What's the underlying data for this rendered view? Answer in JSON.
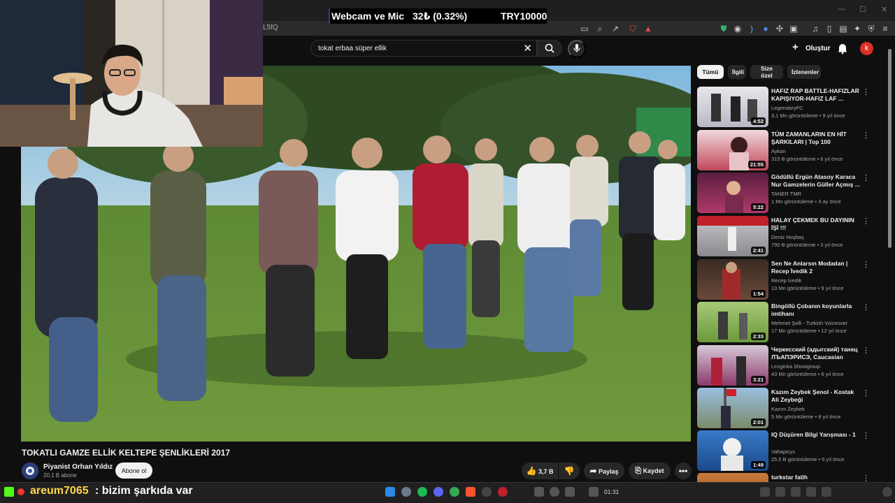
{
  "overlay": {
    "banner_label": "Webcam ve Mic",
    "banner_amount": "32₺ (0.32%)",
    "banner_goal": "TRY10000"
  },
  "browser": {
    "url_fragment": "L5fQ"
  },
  "header": {
    "search_query": "tokat erbaa süper ellik",
    "create_label": "Oluştur",
    "avatar_letter": "k"
  },
  "video": {
    "title": "TOKATLI GAMZE ELLİK KELTEPE ŞENLİKLERİ 2017",
    "channel": "Piyanist Orhan Yıldız",
    "subscribers": "20,1 B abone",
    "subscribe_label": "Abone ol",
    "likes": "3,7 B",
    "share_label": "Paylaş",
    "save_label": "Kaydet"
  },
  "sidebar": {
    "chips": [
      "Tümü",
      "İlgili",
      "Size özel",
      "İzlenenler"
    ],
    "items": [
      {
        "title": "HAFIZ RAP BATTLE-HAFIZLAR KAPIŞIYOR-HAFIZ LAF ...",
        "channel": "LegendaryFC",
        "meta": "3,1 Mn görüntüleme • 9 yıl önce",
        "duration": "4:52"
      },
      {
        "title": "TÜM ZAMANLARIN EN HİT ŞARKILARI | Top 100",
        "channel": "Aykan",
        "meta": "315 B görüntüleme • 6 yıl önce",
        "duration": "21:55"
      },
      {
        "title": "Gödüllü Ergün Atasoy Karaca Nur Gamzelerin Güller Açmış ...",
        "channel": "TANER TMR",
        "meta": "1 Mn görüntüleme • 3 ay önce",
        "duration": "5:22"
      },
      {
        "title": "HALAY ÇEKMEK BU DAYININ İŞİ !!!",
        "channel": "Deniz Hoşbaş",
        "meta": "790 B görüntüleme • 3 yıl önce",
        "duration": "2:41"
      },
      {
        "title": "Sen Ne Anlarsın Modadan | Recep İvedik 2",
        "channel": "Recep İvedik",
        "meta": "13 Mn görüntüleme • 9 yıl önce",
        "duration": "1:54"
      },
      {
        "title": "Bingöllü Çobanın koyunlarla imtihanı",
        "channel": "Mehmet Şelli - Turkish Voiceover",
        "meta": "17 Mn görüntüleme • 12 yıl önce",
        "duration": "2:33"
      },
      {
        "title": "Черкесский (адыгский) танец ЛЪАПЭРИСЭ, Caucasian dance",
        "channel": "Lezginka Showgroup",
        "meta": "43 Mn görüntüleme • 6 yıl önce",
        "duration": "3:21"
      },
      {
        "title": "Kazım Zeybek Şenol - Kostak Ali Zeybeği",
        "channel": "Kazım Zeybek",
        "meta": "5 Mn görüntüleme • 8 yıl önce",
        "duration": "2:01"
      },
      {
        "title": "IQ Düşüren Bilgi Yarışması - 1",
        "channel": "Vahapicys",
        "meta": "25,5 B görüntüleme • 5 yıl önce",
        "duration": "1:49"
      },
      {
        "title": "turkstar fatih",
        "channel": "",
        "meta": "",
        "duration": ""
      }
    ]
  },
  "chat": {
    "user": "areum7065",
    "message": ": bizim şarkıda var"
  },
  "taskbar": {
    "time": "01:31"
  },
  "colors": {
    "accent_red": "#d93025",
    "background": "#0f0f0f",
    "chat_user": "#ffd84a"
  }
}
